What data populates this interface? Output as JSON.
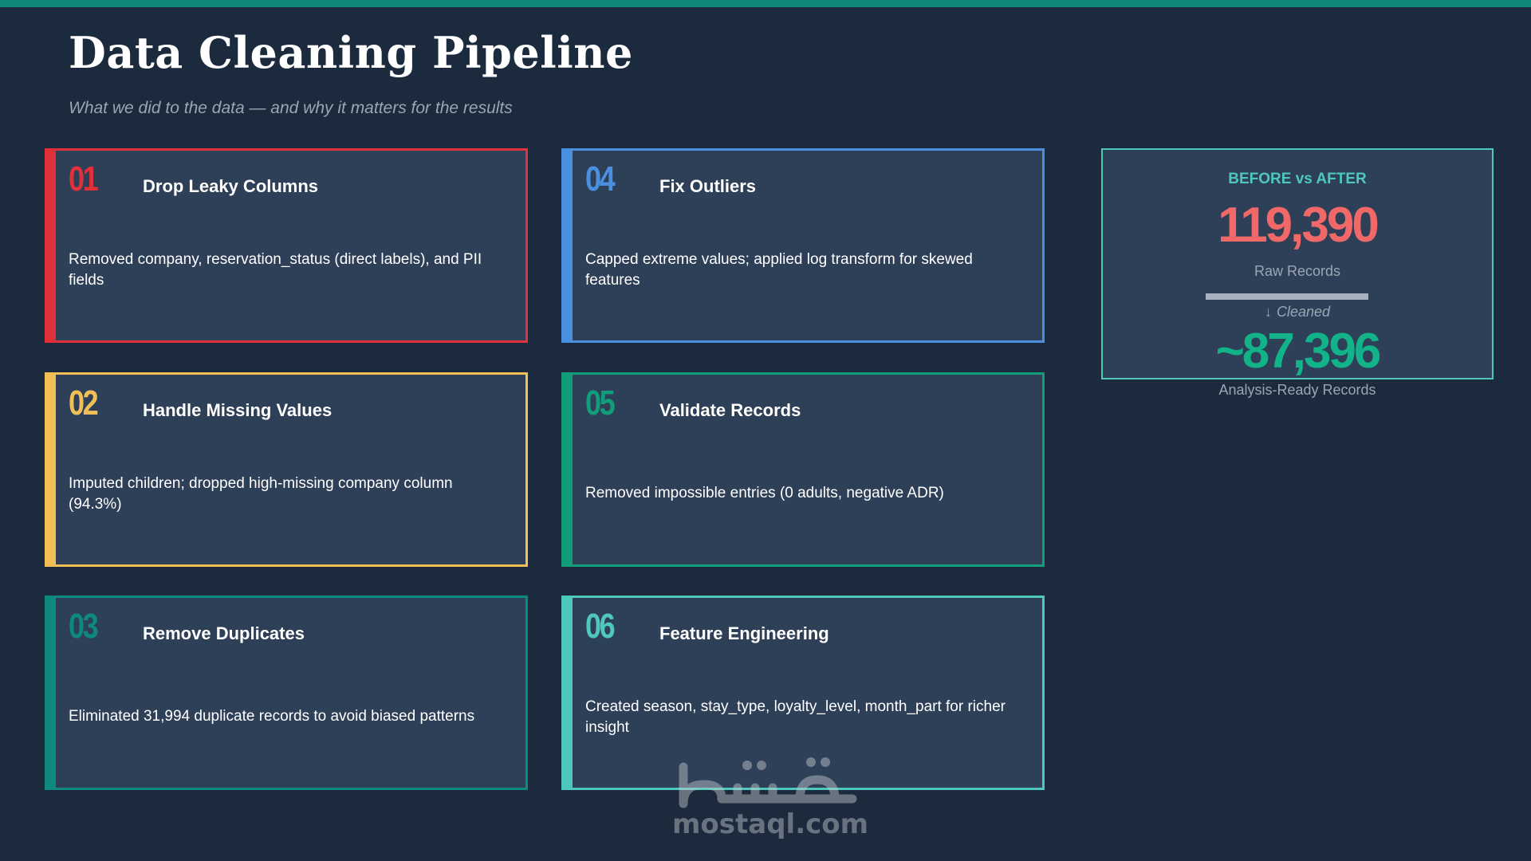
{
  "slide": {
    "title": "Data Cleaning Pipeline",
    "subtitle": "What we did to the data — and why it matters for the results"
  },
  "steps": [
    {
      "number": "01",
      "title": "Drop Leaky Columns",
      "description": "Removed company, reservation_status (direct labels), and PII fields",
      "color": "#e0303a"
    },
    {
      "number": "02",
      "title": "Handle Missing Values",
      "description": "Imputed children; dropped high-missing company column (94.3%)",
      "color": "#f2bf57"
    },
    {
      "number": "03",
      "title": "Remove Duplicates",
      "description": "Eliminated 31,994 duplicate records to avoid biased patterns",
      "color": "#0d8a7d"
    },
    {
      "number": "04",
      "title": "Fix Outliers",
      "description": "Capped extreme values; applied log transform for skewed features",
      "color": "#4a8fe0"
    },
    {
      "number": "05",
      "title": "Validate Records",
      "description": "Removed impossible entries (0 adults, negative ADR)",
      "color": "#119c7a"
    },
    {
      "number": "06",
      "title": "Feature Engineering",
      "description": "Created season, stay_type, loyalty_level, month_part for richer insight",
      "color": "#4fc8bc"
    }
  ],
  "summary": {
    "header": "BEFORE vs AFTER",
    "raw_value": "119,390",
    "raw_label": "Raw Records",
    "cleaned_label": "Cleaned",
    "clean_value": "~87,396",
    "clean_label": "Analysis-Ready Records",
    "colors": {
      "raw": "#f06868",
      "clean": "#13b38a",
      "accent": "#4fc8bc"
    }
  },
  "watermark": {
    "logo_text": "مستقل",
    "text": "mostaql.com"
  }
}
